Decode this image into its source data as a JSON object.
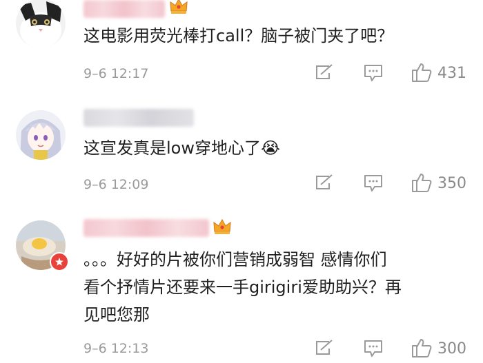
{
  "comments": [
    {
      "text": "这电影用荧光棒打call？脑子被门夹了吧？",
      "time": "9–6 12:17",
      "likes": "431",
      "avatar_icon": "cat-avatar-icon",
      "has_crown": true
    },
    {
      "text": "这宣发真是low穿地心了😭",
      "time": "9–6 12:09",
      "likes": "350",
      "avatar_icon": "anime-girl-avatar-icon",
      "has_crown": false
    },
    {
      "text": "。。。好好的片被你们营销成弱智 感情你们\n看个抒情片还要来一手girigiri爱助助兴？再\n见吧您那",
      "time": "9–6 12:13",
      "likes": "300",
      "avatar_icon": "food-avatar-icon",
      "has_crown": true
    }
  ],
  "icons": {
    "repost": "share-edit-icon",
    "comment": "comment-bubble-icon",
    "like": "thumbs-up-icon",
    "crown": "crown-icon",
    "badge": "weibo-badge-icon"
  },
  "colors": {
    "text": "#1f1f1f",
    "meta": "#9a9a9a",
    "crown": "#f5a623"
  }
}
